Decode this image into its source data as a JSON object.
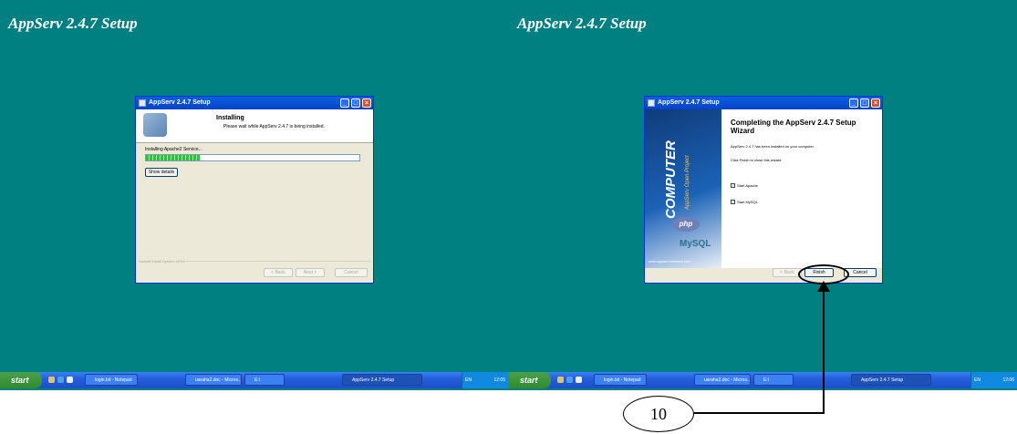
{
  "left_screen": {
    "desktop_title": "AppServ 2.4.7 Setup",
    "window": {
      "title": "AppServ 2.4.7 Setup",
      "header_title": "Installing",
      "header_subtitle": "Please wait while AppServ 2.4.7 is being installed.",
      "status_text": "Installing Apache2 Service...",
      "progress_percent": 25,
      "show_details_label": "Show details",
      "brand_text": "Nullsoft Install System v2.14",
      "back_label": "< Back",
      "next_label": "Next >",
      "cancel_label": "Cancel"
    },
    "taskbar": {
      "start_label": "start",
      "items": [
        "login.txt - Notepad",
        "uaraha2.doc - Micros...",
        "E:\\",
        "AppServ 2.4.7 Setup"
      ],
      "tray_lang": "EN",
      "clock": "12:05"
    }
  },
  "right_screen": {
    "desktop_title": "AppServ 2.4.7 Setup",
    "window": {
      "title": "AppServ 2.4.7 Setup",
      "banner_text": "COMPUTER",
      "banner_subtext": "AppServ Open Project",
      "php_logo": "php",
      "mysql_logo": "MySQL",
      "banner_url": "www.appservnetwork.com",
      "heading": "Completing the AppServ 2.4.7 Setup Wizard",
      "para1": "AppServ 2.4.7 has been installed on your computer.",
      "para2": "Click Finish to close this wizard.",
      "checkbox1_label": "Start Apache",
      "checkbox2_label": "Start MySQL",
      "back_label": "< Back",
      "finish_label": "Finish",
      "cancel_label": "Cancel"
    },
    "taskbar": {
      "start_label": "start",
      "items": [
        "login.txt - Notepad",
        "uaraha2.doc - Micros...",
        "E:\\",
        "AppServ 2.4.7 Setup"
      ],
      "tray_lang": "EN",
      "clock": "12:06"
    }
  },
  "callout": {
    "number": "10"
  }
}
